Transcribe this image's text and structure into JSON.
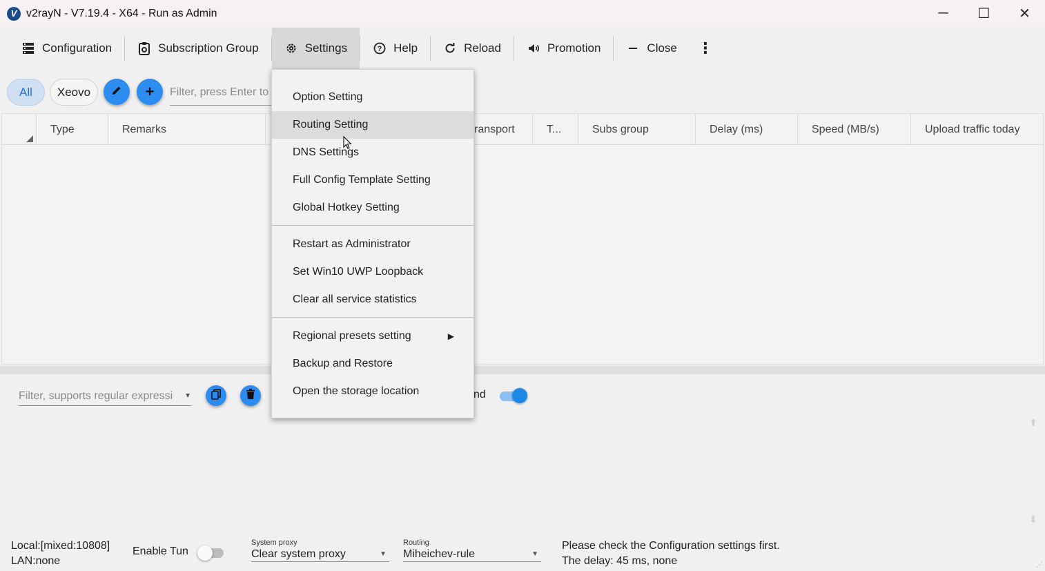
{
  "window": {
    "title": "v2rayN - V7.19.4 - X64 - Run as Admin",
    "app_icon": "v2rayn-logo-icon",
    "controls": {
      "minimize": "─",
      "maximize": "☐",
      "close": "✕"
    }
  },
  "toolbar": {
    "items": [
      {
        "label": "Configuration",
        "icon": "server-icon"
      },
      {
        "label": "Subscription Group",
        "icon": "subscription-icon"
      },
      {
        "label": "Settings",
        "icon": "gear-icon",
        "active": true
      },
      {
        "label": "Help",
        "icon": "help-icon"
      },
      {
        "label": "Reload",
        "icon": "reload-icon"
      },
      {
        "label": "Promotion",
        "icon": "speaker-icon"
      },
      {
        "label": "Close",
        "icon": "minus-icon"
      }
    ],
    "more_icon": "⋮"
  },
  "filters": {
    "chips": [
      "All",
      "Xeovo"
    ],
    "edit_icon": "✎",
    "add_icon": "+",
    "filter_placeholder": "Filter, press Enter to"
  },
  "grid": {
    "columns": [
      "Type",
      "Remarks",
      "ransport",
      "T...",
      "Subs group",
      "Delay (ms)",
      "Speed (MB/s)",
      "Upload traffic today"
    ]
  },
  "settings_menu": {
    "groups": [
      [
        "Option Setting",
        "Routing Setting",
        "DNS Settings",
        "Full Config Template Setting",
        "Global Hotkey Setting"
      ],
      [
        "Restart as Administrator",
        "Set Win10 UWP Loopback",
        "Clear all service statistics"
      ],
      [
        "Regional presets setting",
        "Backup and Restore",
        "Open the storage location"
      ]
    ],
    "highlighted": "Routing Setting",
    "submenu_arrow": "▶"
  },
  "log_panel": {
    "filter_placeholder": "Filter, supports regular expressi",
    "partial_label": "nd",
    "toggle_on": true
  },
  "status": {
    "local": "Local:[mixed:10808]",
    "lan": "LAN:none",
    "tun_label": "Enable Tun",
    "tun_enabled": false,
    "system_proxy_caption": "System proxy",
    "system_proxy_value": "Clear system proxy",
    "routing_caption": "Routing",
    "routing_value": "Miheichev-rule",
    "message_line1": "Please check the Configuration settings first.",
    "message_line2": "The delay: 45 ms, none"
  },
  "colors": {
    "accent": "#2d8cf0",
    "chip_selected_bg": "#cfe0f3",
    "menu_highlight": "#dcdcdc"
  }
}
